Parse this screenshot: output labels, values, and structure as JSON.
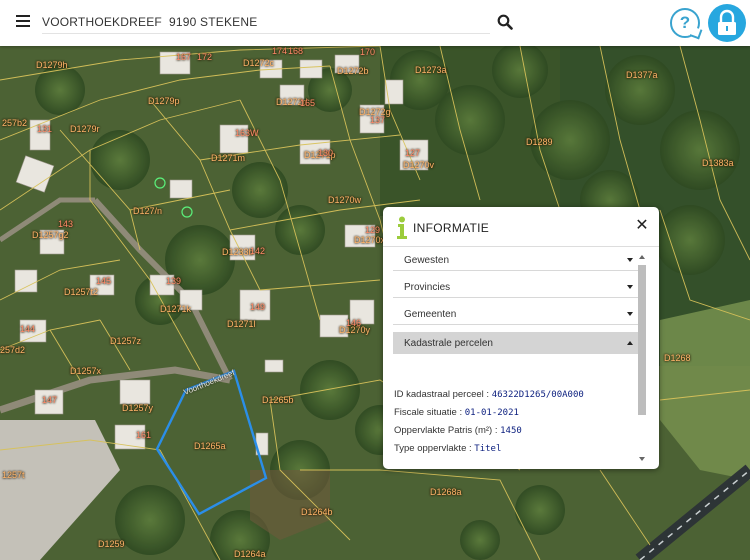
{
  "search": {
    "value": "VOORTHOEKDREEF  9190 STEKENE"
  },
  "colors": {
    "accent": "#27a7df",
    "parcel_line": "#d8c25a",
    "selected_parcel": "#2b8ee8",
    "label": "#ffb46a",
    "detail_value": "#0f2280"
  },
  "icons": {
    "menu": "hamburger-menu-icon",
    "search": "magnifier-icon",
    "help": "question-speech-bubble-icon",
    "lock": "padlock-icon",
    "info": "info-i-icon",
    "close": "close-x-icon"
  },
  "map": {
    "street_label": "Voorthoekdreef",
    "parcel_labels": [
      "D1279h",
      "D1272c",
      "D1272b",
      "D1273a",
      "D1377a",
      "D1279p",
      "D1272d",
      "D1272g",
      "257b2",
      "D1279r",
      "D1271m",
      "D1289",
      "D1383a",
      "D1271p",
      "D1270v",
      "D127/n",
      "D1270w",
      "D1257g2",
      "D1233b",
      "D1270x",
      "D1257t2",
      "D1271k",
      "D1271l",
      "D1270y",
      "257d2",
      "D1257z",
      "D1257x",
      "D1268",
      "D1257y",
      "D1265b",
      "D1265a",
      "1257t",
      "D1268a",
      "D1264b",
      "D1259",
      "D1264a"
    ],
    "house_number_labels": [
      "167",
      "172",
      "174",
      "168",
      "170",
      "163W",
      "165",
      "137",
      "127",
      "131",
      "130",
      "129",
      "143",
      "142",
      "145",
      "144",
      "139",
      "149",
      "146",
      "147",
      "161",
      "119",
      "114",
      "135",
      "133",
      "125",
      "118",
      "120",
      "128",
      "130W",
      "132W",
      "135W",
      "149W",
      "153W"
    ]
  },
  "panel": {
    "title": "INFORMATIE",
    "accordion": [
      {
        "label": "Gewesten",
        "open": false
      },
      {
        "label": "Provincies",
        "open": false
      },
      {
        "label": "Gemeenten",
        "open": false
      },
      {
        "label": "Kadastrale percelen",
        "open": true
      }
    ],
    "details": [
      {
        "label": "ID kadastraal perceel : ",
        "value": "46322D1265/00A000"
      },
      {
        "label": "Fiscale situatie : ",
        "value": "01-01-2021"
      },
      {
        "label": "Oppervlakte Patris (m²) : ",
        "value": "1450"
      },
      {
        "label": "Type oppervlakte : ",
        "value": "Titel"
      }
    ]
  }
}
